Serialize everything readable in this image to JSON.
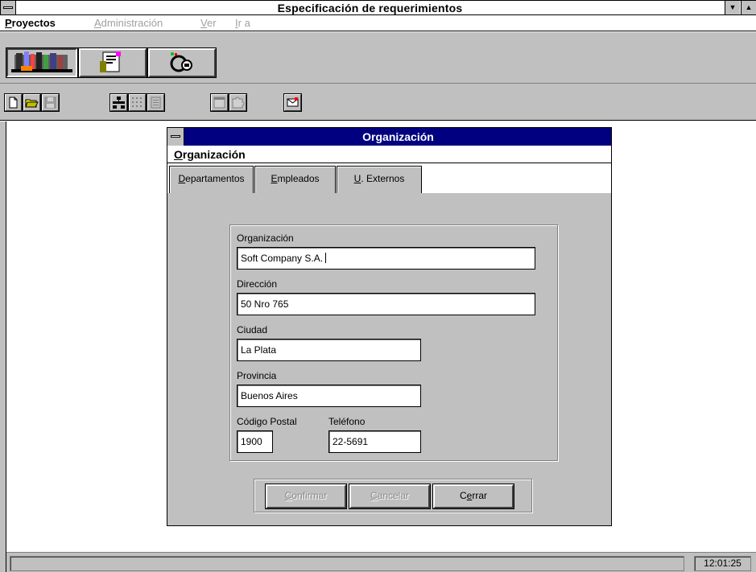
{
  "window": {
    "title": "Especificación de requerimientos",
    "dropdown_glyph": "▼",
    "scroll_glyph": "▲"
  },
  "menu": [
    {
      "label": "Proyectos",
      "enabled": true
    },
    {
      "label": "Administración",
      "enabled": false
    },
    {
      "label": "Ver",
      "enabled": false
    },
    {
      "label": "Ir a",
      "enabled": false
    }
  ],
  "module_toolbar": [
    {
      "icon": "projects-module-icon",
      "pressed": true
    },
    {
      "icon": "documents-module-icon",
      "pressed": false
    },
    {
      "icon": "keys-module-icon",
      "pressed": false
    }
  ],
  "tool_icons": [
    "new-document-icon",
    "open-folder-icon",
    "save-disk-icon",
    "network-icon",
    "dotted-grid-icon",
    "list-icon",
    "window-icon",
    "puzzle-icon",
    "envelope-icon"
  ],
  "child_window": {
    "title": "Organización",
    "menu_label": "Organización",
    "tabs": [
      {
        "label": "Departamentos",
        "mnemonic": "D"
      },
      {
        "label": "Empleados",
        "mnemonic": "E"
      },
      {
        "label": "U. Externos",
        "mnemonic": "U"
      }
    ],
    "form": {
      "organizacion_label": "Organización",
      "organizacion_value": "Soft Company S.A.",
      "direccion_label": "Dirección",
      "direccion_value": "50 Nro 765",
      "ciudad_label": "Ciudad",
      "ciudad_value": "La Plata",
      "provincia_label": "Provincia",
      "provincia_value": "Buenos Aires",
      "codigo_postal_label": "Código Postal",
      "codigo_postal_value": "1900",
      "telefono_label": "Teléfono",
      "telefono_value": "22-5691"
    },
    "buttons": {
      "confirmar": "Confirmar",
      "cancelar": "Cancelar",
      "cerrar": "Cerrar"
    }
  },
  "status": {
    "message": "",
    "clock": "12:01:25"
  },
  "colors": {
    "active_title": "#000080",
    "face": "#c0c0c0",
    "disabled_text": "#a0a0a0"
  }
}
